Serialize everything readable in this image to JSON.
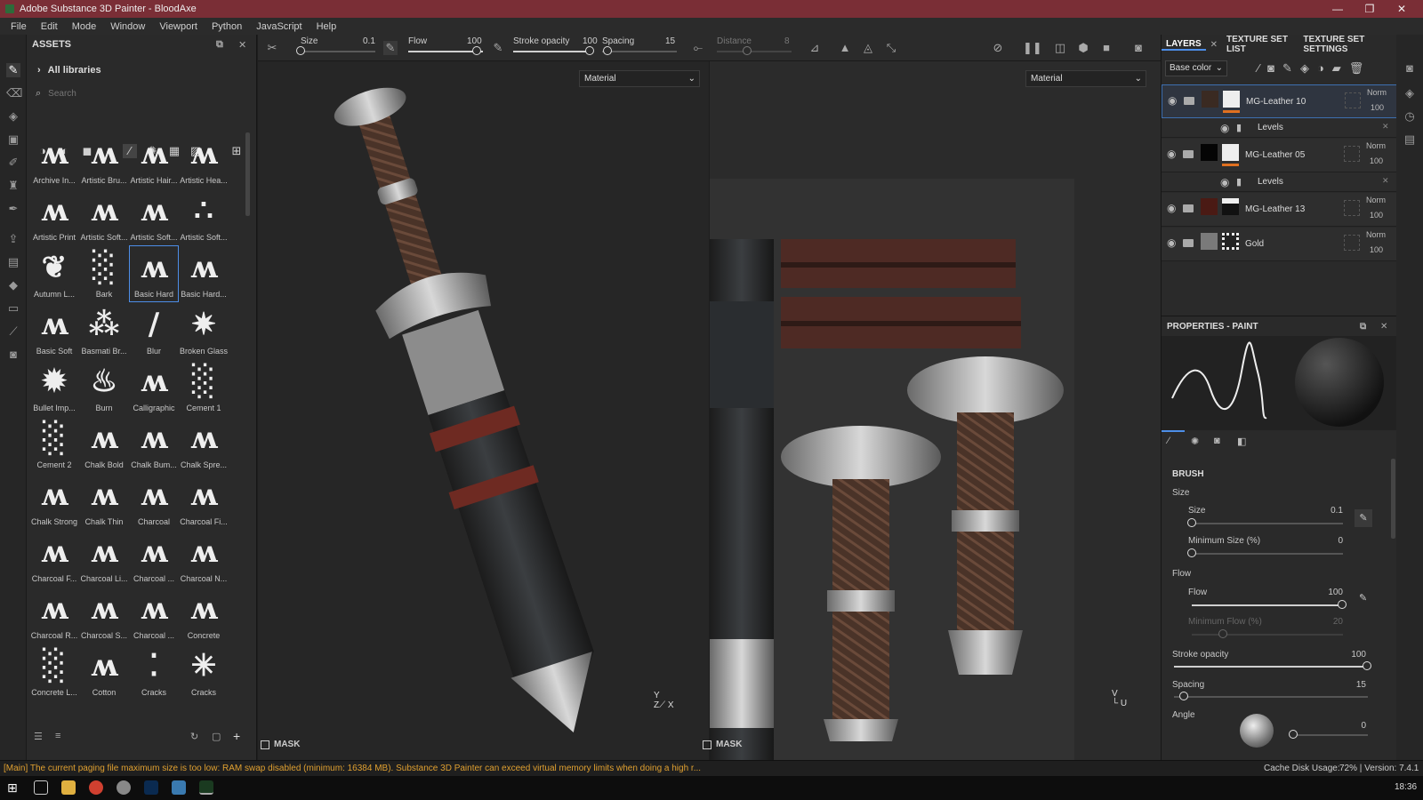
{
  "window": {
    "title": "Adobe Substance 3D Painter - BloodAxe"
  },
  "menu": [
    "File",
    "Edit",
    "Mode",
    "Window",
    "Viewport",
    "Python",
    "JavaScript",
    "Help"
  ],
  "assets": {
    "title": "ASSETS",
    "library": "All libraries",
    "search_placeholder": "Search",
    "brushes": [
      "Archive In...",
      "Artistic Bru...",
      "Artistic Hair...",
      "Artistic Hea...",
      "Artistic Print",
      "Artistic Soft...",
      "Artistic Soft...",
      "Artistic Soft...",
      "Autumn L...",
      "Bark",
      "Basic Hard",
      "Basic Hard...",
      "Basic Soft",
      "Basmati Br...",
      "Blur",
      "Broken Glass",
      "Bullet Imp...",
      "Burn",
      "Calligraphic",
      "Cement 1",
      "Cement 2",
      "Chalk Bold",
      "Chalk Bum...",
      "Chalk Spre...",
      "Chalk Strong",
      "Chalk Thin",
      "Charcoal",
      "Charcoal Fi...",
      "Charcoal F...",
      "Charcoal Li...",
      "Charcoal ...",
      "Charcoal N...",
      "Charcoal R...",
      "Charcoal S...",
      "Charcoal ...",
      "Concrete",
      "Concrete L...",
      "Cotton",
      "Cracks",
      "Cracks"
    ],
    "selected_brush": "Basic Hard"
  },
  "toolbar": {
    "size_label": "Size",
    "size_value": "0.1",
    "flow_label": "Flow",
    "flow_value": "100",
    "stroke_opacity_label": "Stroke opacity",
    "stroke_opacity_value": "100",
    "spacing_label": "Spacing",
    "spacing_value": "15",
    "distance_label": "Distance",
    "distance_value": "8"
  },
  "viewport3d": {
    "material": "Material",
    "mask": "MASK"
  },
  "viewport2d": {
    "material": "Material",
    "mask": "MASK"
  },
  "layers": {
    "tabs": [
      "LAYERS",
      "TEXTURE SET LIST",
      "TEXTURE SET SETTINGS"
    ],
    "channel": "Base color",
    "items": [
      {
        "name": "MG-Leather 10",
        "blend": "Norm",
        "opacity": "100",
        "sub": "Levels"
      },
      {
        "name": "MG-Leather 05",
        "blend": "Norm",
        "opacity": "100",
        "sub": "Levels"
      },
      {
        "name": "MG-Leather 13",
        "blend": "Norm",
        "opacity": "100"
      },
      {
        "name": "Gold",
        "blend": "Norm",
        "opacity": "100"
      }
    ]
  },
  "properties": {
    "title": "PROPERTIES - PAINT",
    "section": "BRUSH",
    "size_group": "Size",
    "size_label": "Size",
    "size_value": "0.1",
    "min_size_label": "Minimum Size (%)",
    "min_size_value": "0",
    "flow_group": "Flow",
    "flow_label": "Flow",
    "flow_value": "100",
    "min_flow_label": "Minimum Flow (%)",
    "min_flow_value": "20",
    "stroke_opacity_label": "Stroke opacity",
    "stroke_opacity_value": "100",
    "spacing_label": "Spacing",
    "spacing_value": "15",
    "angle_label": "Angle",
    "angle_value": "0"
  },
  "status": {
    "message": "[Main] The current paging file maximum size is too low: RAM swap disabled (minimum: 16384 MB). Substance 3D Painter can exceed virtual memory limits when doing a high r...",
    "cache": "Cache Disk Usage:",
    "cache_value": "72% | Version: 7.4.1"
  },
  "taskbar": {
    "clock": "18:36"
  },
  "colors": {
    "titlebar": "#7a2e36",
    "accent": "#4d8ee8",
    "warning": "#e0a030",
    "leather": "#5a3a2c"
  }
}
